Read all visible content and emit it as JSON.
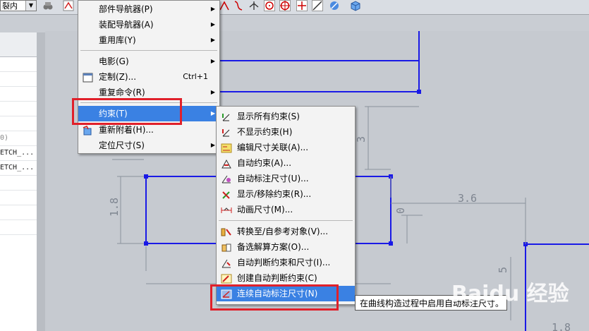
{
  "toolbar": {
    "view_select_value": "裂内",
    "icons": [
      "constraint-toolbar-icon",
      "arc-icon",
      "fillet-icon",
      "point-icon",
      "circle-icon",
      "cross-icon",
      "line-icon",
      "curve-icon",
      "box-icon"
    ]
  },
  "left_panel": {
    "rows": [
      "",
      "",
      "",
      "",
      "",
      "0)",
      "ETCH_...",
      "ETCH_...",
      "",
      "",
      "",
      ""
    ]
  },
  "canvas": {
    "dims": [
      "3.6",
      "1.8",
      "3",
      "0",
      "5",
      "1.8"
    ]
  },
  "menu": {
    "items": [
      {
        "label": "部件导航器(P)"
      },
      {
        "label": "装配导航器(A)"
      },
      {
        "label": "重用库(Y)"
      },
      {
        "label": "电影(G)"
      },
      {
        "label": "定制(Z)...",
        "shortcut": "Ctrl+1"
      },
      {
        "label": "重复命令(R)"
      },
      {
        "label": "约束(T)"
      },
      {
        "label": "重新附着(H)..."
      },
      {
        "label": "定位尺寸(S)"
      }
    ]
  },
  "submenu": {
    "items": [
      {
        "label": "显示所有约束(S)"
      },
      {
        "label": "不显示约束(H)"
      },
      {
        "label": "编辑尺寸关联(A)..."
      },
      {
        "label": "自动约束(A)..."
      },
      {
        "label": "自动标注尺寸(U)..."
      },
      {
        "label": "显示/移除约束(R)..."
      },
      {
        "label": "动画尺寸(M)..."
      },
      {
        "label": "转换至/自参考对象(V)..."
      },
      {
        "label": "备选解算方案(O)..."
      },
      {
        "label": "自动判断约束和尺寸(I)..."
      },
      {
        "label": "创建自动判断约束(C)"
      },
      {
        "label": "连续自动标注尺寸(N)"
      }
    ]
  },
  "tooltip": {
    "text": "在曲线构造过程中启用自动标注尺寸。"
  },
  "watermark": {
    "text": "Baidu 经验"
  },
  "colors": {
    "sketch_line": "#1a1ae6",
    "highlight": "#3a81e3",
    "callout": "#e0202a"
  }
}
